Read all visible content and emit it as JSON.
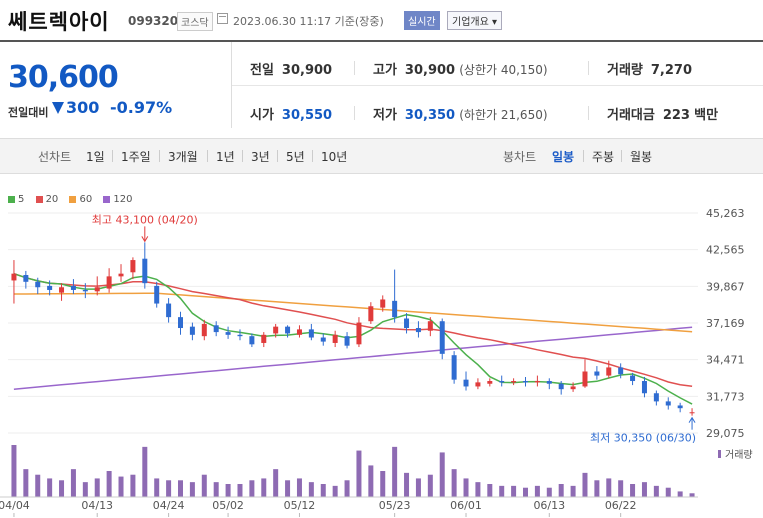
{
  "header": {
    "name": "쎄트렉아이",
    "code": "099320",
    "market": "코스닥",
    "datetime": "2023.06.30 11:17 기준(장중)",
    "realtime_label": "실시간",
    "info_label": "기업개요"
  },
  "price": {
    "current": "30,600",
    "change_label": "전일대비",
    "change": "300",
    "change_pct": "-0.97%"
  },
  "stats": {
    "prev_close": {
      "label": "전일",
      "value": "30,900"
    },
    "high": {
      "label": "고가",
      "value": "30,900",
      "sub": "(상한가 40,150)"
    },
    "volume": {
      "label": "거래량",
      "value": "7,270"
    },
    "open": {
      "label": "시가",
      "value": "30,550"
    },
    "low": {
      "label": "저가",
      "value": "30,350",
      "sub": "(하한가 21,650)"
    },
    "amount": {
      "label": "거래대금",
      "value": "223",
      "unit": "백만"
    }
  },
  "tabs": {
    "line_label": "선차트",
    "periods": [
      "1일",
      "1주일",
      "3개월",
      "1년",
      "3년",
      "5년",
      "10년"
    ],
    "candle_label": "봉차트",
    "candles": [
      "일봉",
      "주봉",
      "월봉"
    ],
    "active_candle": "일봉"
  },
  "colors": {
    "up": "#e03b3b",
    "down": "#2f6cd1",
    "ma5": "#4cb04c",
    "ma20": "#e05050",
    "ma60": "#f0a040",
    "ma120": "#9966cc",
    "volume": "#8e6bb3"
  },
  "chart_data": {
    "type": "candlestick",
    "legend": [
      "5",
      "20",
      "60",
      "120"
    ],
    "ylim": [
      29075,
      45263
    ],
    "y_ticks": [
      "45,263",
      "42,565",
      "39,867",
      "37,169",
      "34,471",
      "31,773",
      "29,075"
    ],
    "x_ticks": [
      "04/04",
      "04/13",
      "04/24",
      "05/02",
      "05/12",
      "05/23",
      "06/01",
      "06/13",
      "06/22"
    ],
    "x_tick_index": [
      0,
      7,
      13,
      18,
      24,
      32,
      38,
      45,
      51
    ],
    "volume_label": "거래량",
    "max_annotation": {
      "text": "최고 43,100 (04/20)",
      "index": 11,
      "value": 43100
    },
    "min_annotation": {
      "text": "최저 30,350 (06/30)",
      "index": 57,
      "value": 30350
    },
    "candles": [
      [
        40300,
        40800,
        41800,
        38600
      ],
      [
        40700,
        40200,
        41000,
        39700
      ],
      [
        40200,
        39800,
        40500,
        39300
      ],
      [
        39900,
        39600,
        40300,
        39200
      ],
      [
        39400,
        39800,
        40100,
        38800
      ],
      [
        39900,
        39600,
        40400,
        39300
      ],
      [
        39600,
        39500,
        40100,
        39000
      ],
      [
        39500,
        39800,
        40600,
        39200
      ],
      [
        39700,
        40600,
        41200,
        39400
      ],
      [
        40600,
        40800,
        41500,
        40200
      ],
      [
        40900,
        41800,
        42000,
        40400
      ],
      [
        41900,
        40100,
        43100,
        39700
      ],
      [
        39900,
        38600,
        40200,
        38300
      ],
      [
        38600,
        37600,
        39000,
        37200
      ],
      [
        37600,
        36800,
        38000,
        36300
      ],
      [
        36900,
        36300,
        37200,
        35900
      ],
      [
        36200,
        37100,
        37400,
        35900
      ],
      [
        37000,
        36500,
        37300,
        36200
      ],
      [
        36500,
        36300,
        36900,
        36000
      ],
      [
        36300,
        36200,
        36700,
        35900
      ],
      [
        36200,
        35600,
        36400,
        35400
      ],
      [
        35700,
        36300,
        36500,
        35400
      ],
      [
        36400,
        36900,
        37100,
        36100
      ],
      [
        36900,
        36400,
        37000,
        36100
      ],
      [
        36300,
        36700,
        37000,
        36100
      ],
      [
        36700,
        36100,
        37100,
        35900
      ],
      [
        36100,
        35800,
        36400,
        35500
      ],
      [
        35700,
        36300,
        36600,
        35400
      ],
      [
        36200,
        35500,
        36500,
        35300
      ],
      [
        35600,
        37200,
        37600,
        35400
      ],
      [
        37300,
        38400,
        38700,
        37100
      ],
      [
        38300,
        38900,
        39200,
        38000
      ],
      [
        38800,
        37600,
        41100,
        37200
      ],
      [
        37500,
        36800,
        37900,
        36400
      ],
      [
        36800,
        36500,
        37300,
        36100
      ],
      [
        36600,
        37300,
        37600,
        36200
      ],
      [
        37300,
        34900,
        37500,
        34500
      ],
      [
        34800,
        33000,
        35100,
        32700
      ],
      [
        33000,
        32500,
        33600,
        32200
      ],
      [
        32500,
        32800,
        33100,
        32300
      ],
      [
        32700,
        32900,
        33100,
        32500
      ],
      [
        32900,
        32800,
        33300,
        32500
      ],
      [
        32800,
        32900,
        33100,
        32600
      ],
      [
        32900,
        32800,
        33200,
        32500
      ],
      [
        32800,
        32900,
        33300,
        32500
      ],
      [
        32900,
        32700,
        33100,
        32300
      ],
      [
        32700,
        32300,
        32900,
        31900
      ],
      [
        32300,
        32500,
        32800,
        32100
      ],
      [
        32500,
        33600,
        34500,
        32400
      ],
      [
        33600,
        33300,
        34000,
        33000
      ],
      [
        33300,
        33900,
        34400,
        33100
      ],
      [
        33900,
        33400,
        34200,
        33100
      ],
      [
        33300,
        32900,
        33500,
        32600
      ],
      [
        32900,
        32000,
        33200,
        31700
      ],
      [
        32000,
        31400,
        32200,
        31100
      ],
      [
        31400,
        31100,
        31700,
        30800
      ],
      [
        31100,
        30900,
        31300,
        30600
      ],
      [
        30550,
        30600,
        30900,
        30350
      ]
    ],
    "volume": [
      28,
      15,
      12,
      10,
      9,
      15,
      8,
      10,
      14,
      11,
      12,
      27,
      10,
      9,
      9,
      8,
      12,
      8,
      7,
      7,
      9,
      10,
      15,
      9,
      10,
      8,
      7,
      6,
      9,
      25,
      17,
      14,
      27,
      13,
      10,
      12,
      24,
      15,
      10,
      8,
      7,
      6,
      6,
      5,
      6,
      5,
      7,
      6,
      13,
      9,
      10,
      9,
      7,
      8,
      6,
      5,
      3,
      2
    ]
  }
}
